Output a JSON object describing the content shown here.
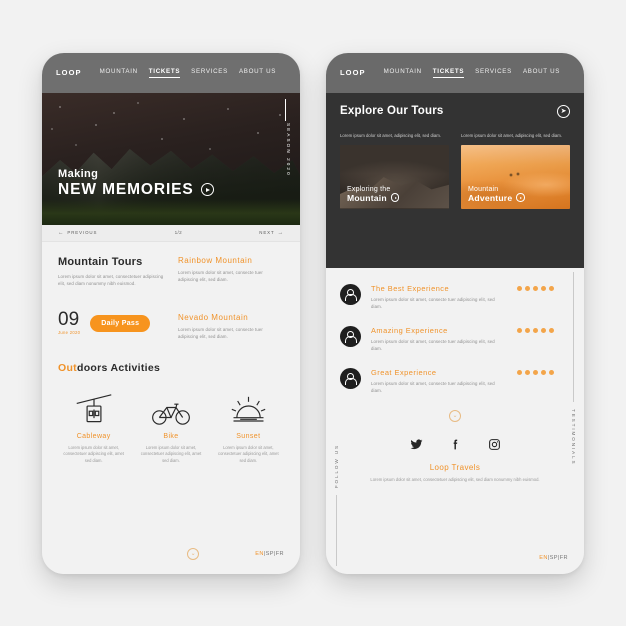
{
  "nav": {
    "brand": "LOOP",
    "links": [
      {
        "label": "MOUNTAIN",
        "active": false
      },
      {
        "label": "TICKETS",
        "active": true
      },
      {
        "label": "SERVICES",
        "active": false
      },
      {
        "label": "ABOUT US",
        "active": false
      }
    ]
  },
  "screen1": {
    "hero": {
      "kicker": "Making",
      "title": "NEW MEMORIES",
      "season": "SEASON 2020",
      "play_icon": "play-icon"
    },
    "pager": {
      "previous": "PREVIOUS",
      "count": "1/2",
      "next": "NEXT"
    },
    "tours": {
      "title": "Mountain Tours",
      "desc": "Lorem ipsum dolor sit amet, consectetuer adipiscing elit, sed diam nonummy nibh euismod.",
      "date_number": "09",
      "date_sub": "June 2020",
      "pass_label": "Daily Pass"
    },
    "listings": [
      {
        "title": "Rainbow Mountain",
        "desc": "Lorem ipsum dolor sit amet, consecte tuer adipiscing elit, sed diam."
      },
      {
        "title": "Nevado Mountain",
        "desc": "Lorem ipsum dolor sit amet, consecte tuer adipiscing elit, sed diam."
      }
    ],
    "outdoors": {
      "highlight": "Out",
      "rest": "doors  Activities"
    },
    "activities": [
      {
        "name": "Cableway",
        "icon": "cable-car-icon",
        "desc": "Lorem ipsum dolor sit amet, consectetuer adipiscing elit, amet sed diam."
      },
      {
        "name": "Bike",
        "icon": "bicycle-icon",
        "desc": "Lorem ipsum dolor sit amet, consectetuer adipiscing elit, amet sed diam."
      },
      {
        "name": "Sunset",
        "icon": "sunset-icon",
        "desc": "Lorem ipsum dolor sit amet, consectetuer adipiscing elit, amet sed diam."
      }
    ],
    "footer": {
      "scroll_icon": "chevron-down-circle-icon",
      "lang_active": "EN",
      "lang_rest": "|SP|FR"
    }
  },
  "screen2": {
    "header": {
      "title": "Explore Our Tours",
      "arrow_icon": "arrow-right-circle-icon"
    },
    "tour_cards": [
      {
        "caption": "Lorem ipsum dolor sit amet, adipiscing elit, sed diam.",
        "line1": "Exploring the",
        "line2": "Mountain",
        "image": "mountain-photo",
        "play_icon": "play-icon"
      },
      {
        "caption": "Lorem ipsum dolor sit amet, adipiscing elit, sed diam.",
        "line1": "Mountain",
        "line2": "Adventure",
        "image": "desert-dunes-photo",
        "play_icon": "play-icon"
      }
    ],
    "testimonials_label": "TESTIMONIALS",
    "testimonials": [
      {
        "title": "The Best Experience",
        "desc": "Lorem ipsum dolor sit amet, consecte tuer adipiscing elit, sed diam.",
        "rating": 5,
        "avatar": "user-avatar-icon"
      },
      {
        "title": "Amazing Experience",
        "desc": "Lorem ipsum dolor sit amet, consecte tuer adipiscing elit, sed diam.",
        "rating": 5,
        "avatar": "user-avatar-icon"
      },
      {
        "title": "Great Experience",
        "desc": "Lorem ipsum dolor sit amet, consecte tuer adipiscing elit, sed diam.",
        "rating": 5,
        "avatar": "user-avatar-icon"
      }
    ],
    "scroll_icon": "chevron-down-circle-icon",
    "follow_label": "FOLLOW US",
    "socials": [
      {
        "name": "twitter-icon"
      },
      {
        "name": "facebook-icon"
      },
      {
        "name": "instagram-icon"
      }
    ],
    "brand": "Loop Travels",
    "brand_desc": "Lorem ipsum dolor sit amet, consectetuer adipiscing elit, sed diam nonummy nibh euismod.",
    "footer": {
      "lang_active": "EN",
      "lang_rest": "|SP|FR"
    }
  },
  "colors": {
    "accent": "#f0932b",
    "accent_solid": "#f7941e",
    "nav_gray": "#6f6f6f",
    "dark": "#333333",
    "page_bg": "#f2f2f2"
  }
}
